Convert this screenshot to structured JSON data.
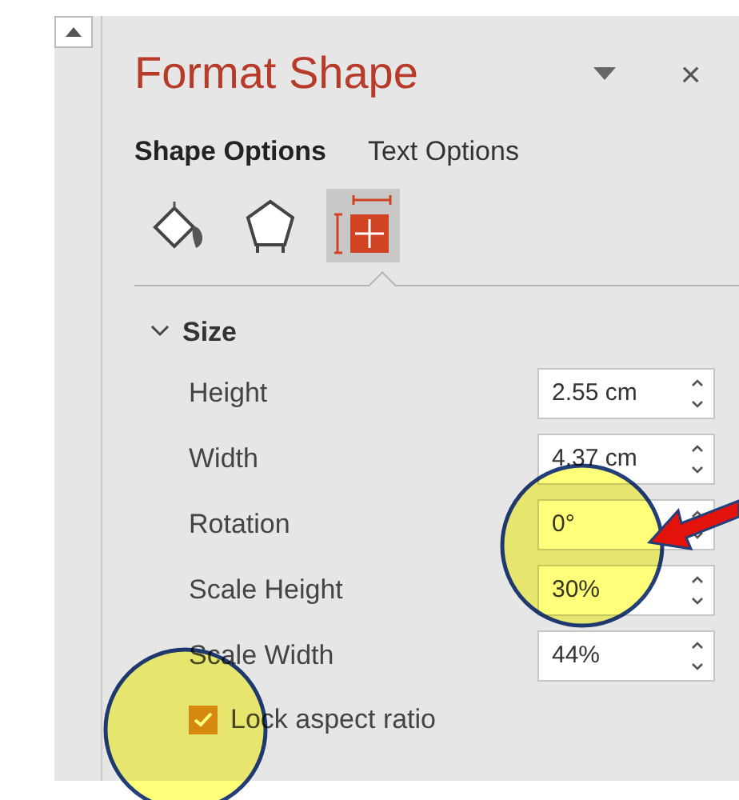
{
  "pane": {
    "title": "Format Shape",
    "close": "×"
  },
  "tabs": [
    {
      "label": "Shape Options",
      "selected": true
    },
    {
      "label": "Text Options",
      "selected": false
    }
  ],
  "categories": [
    {
      "kind": "fill",
      "selected": false
    },
    {
      "kind": "pentagon",
      "selected": false
    },
    {
      "kind": "size",
      "selected": true
    }
  ],
  "section": {
    "title": "Size",
    "expanded": true
  },
  "fields": [
    {
      "label": "Height",
      "value": "2.55 cm"
    },
    {
      "label": "Width",
      "value": "4.37 cm"
    },
    {
      "label": "Rotation",
      "value": "0°"
    },
    {
      "label": "Scale Height",
      "value": "30%"
    },
    {
      "label": "Scale Width",
      "value": "44%"
    }
  ],
  "checkbox": {
    "label": "Lock aspect ratio",
    "checked": true
  }
}
